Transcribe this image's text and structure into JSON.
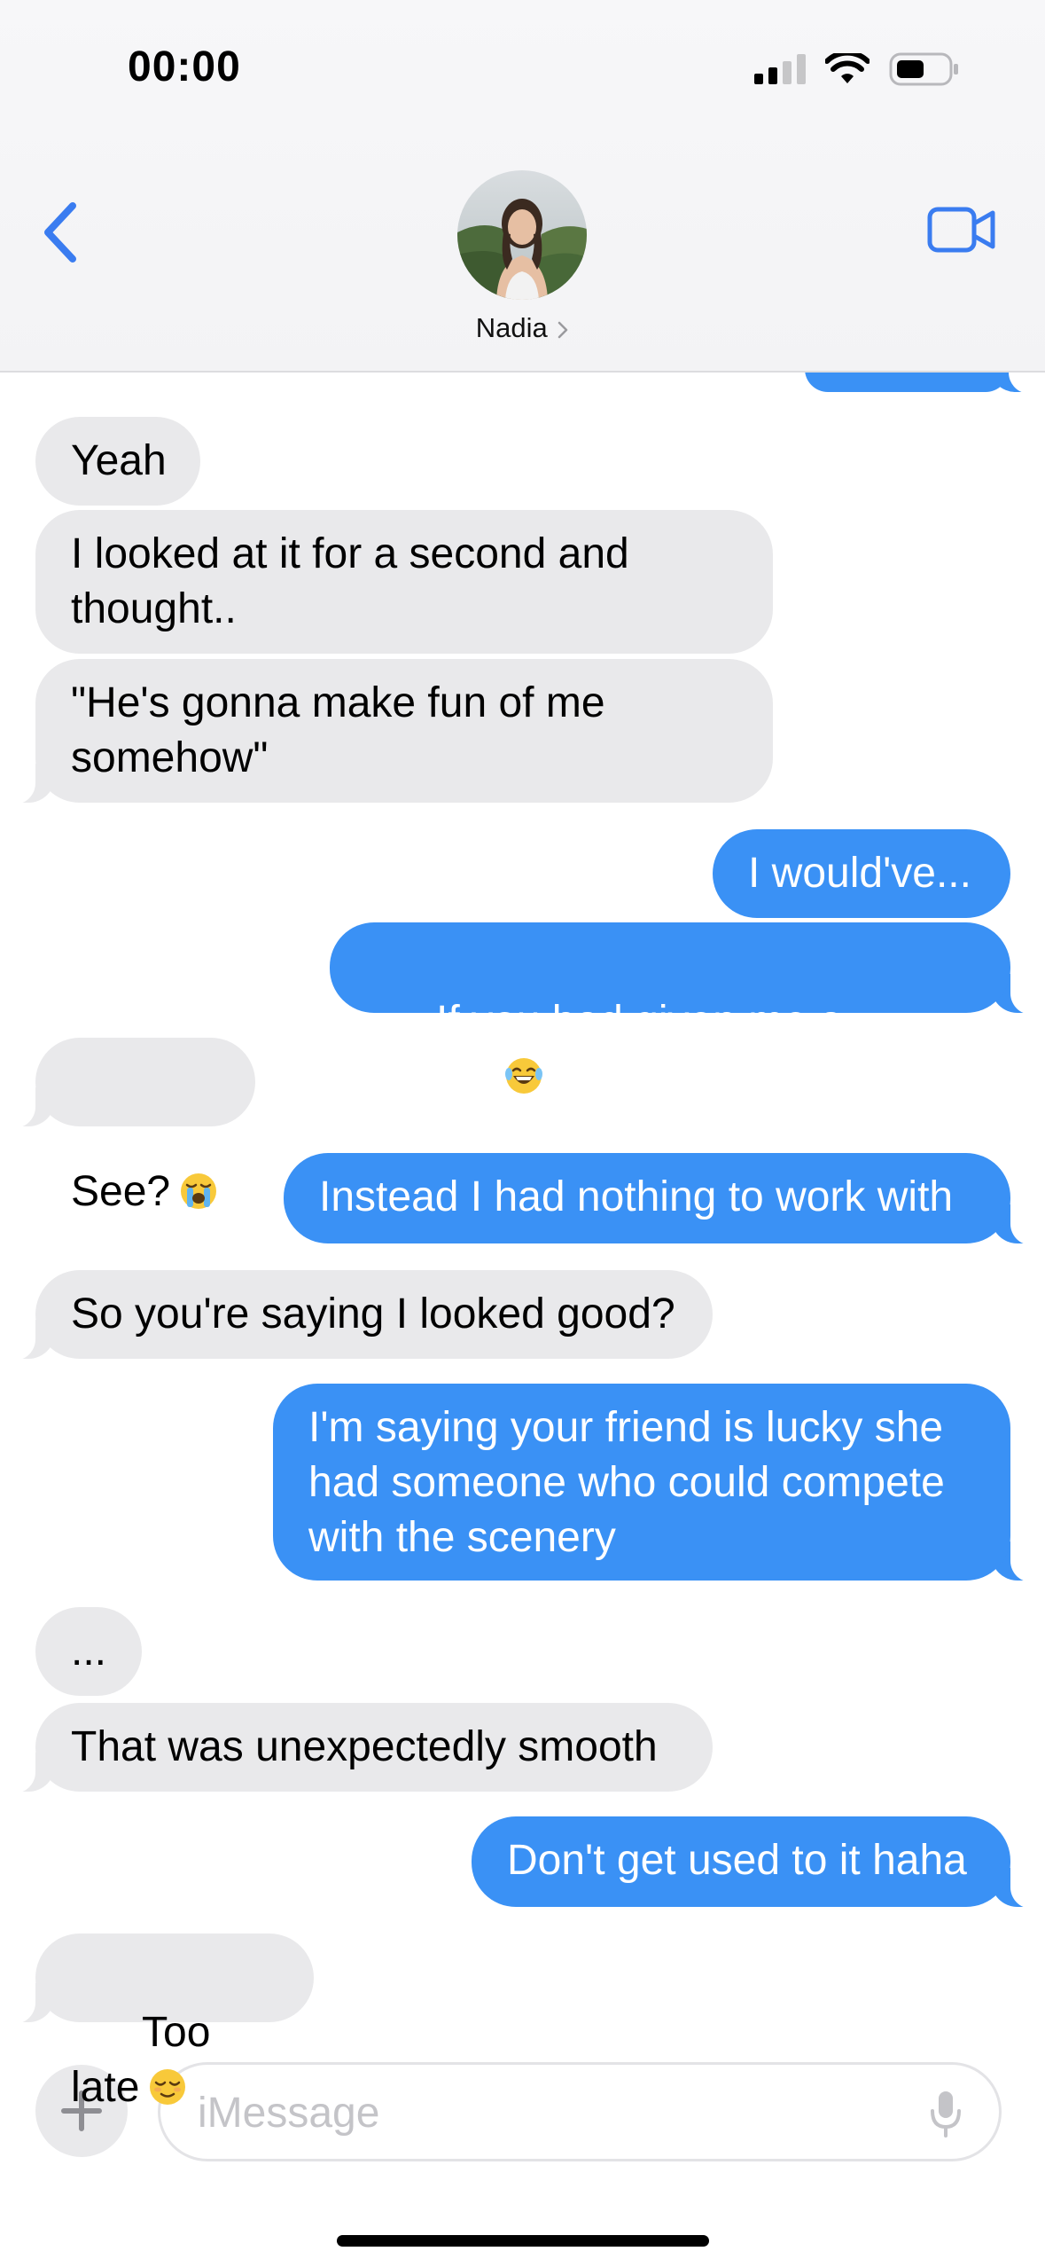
{
  "status_bar": {
    "time": "00:00"
  },
  "header": {
    "contact_name": "Nadia",
    "back_icon": "chevron-left-icon",
    "video_icon": "video-camera-icon"
  },
  "colors": {
    "incoming_bubble": "#e9e9eb",
    "outgoing_bubble": "#3a91f5",
    "accent": "#3a7cf0"
  },
  "messages": [
    {
      "dir": "in",
      "text": "Yeah"
    },
    {
      "dir": "in",
      "text": "I looked at it for a second and\nthought.."
    },
    {
      "dir": "in",
      "text": "\"He's gonna make fun of me\nsomehow\""
    },
    {
      "dir": "out",
      "text": "I would've..."
    },
    {
      "dir": "out",
      "text": "If you had given me a reason",
      "emoji": "laughing-tears-emoji"
    },
    {
      "dir": "in",
      "text": "See?",
      "emoji": "crying-emoji"
    },
    {
      "dir": "out",
      "text": "Instead I had nothing to work with"
    },
    {
      "dir": "in",
      "text": "So you're saying I looked good?"
    },
    {
      "dir": "out",
      "text": "I'm saying your friend is lucky she\nhad someone who could compete\nwith the scenery"
    },
    {
      "dir": "in",
      "text": "..."
    },
    {
      "dir": "in",
      "text": "That was unexpectedly smooth"
    },
    {
      "dir": "out",
      "text": "Don't get used to it haha"
    },
    {
      "dir": "in",
      "text": "Too late",
      "emoji": "relieved-face-emoji"
    }
  ],
  "composer": {
    "placeholder": "iMessage",
    "plus_icon": "plus-icon",
    "mic_icon": "microphone-icon"
  }
}
